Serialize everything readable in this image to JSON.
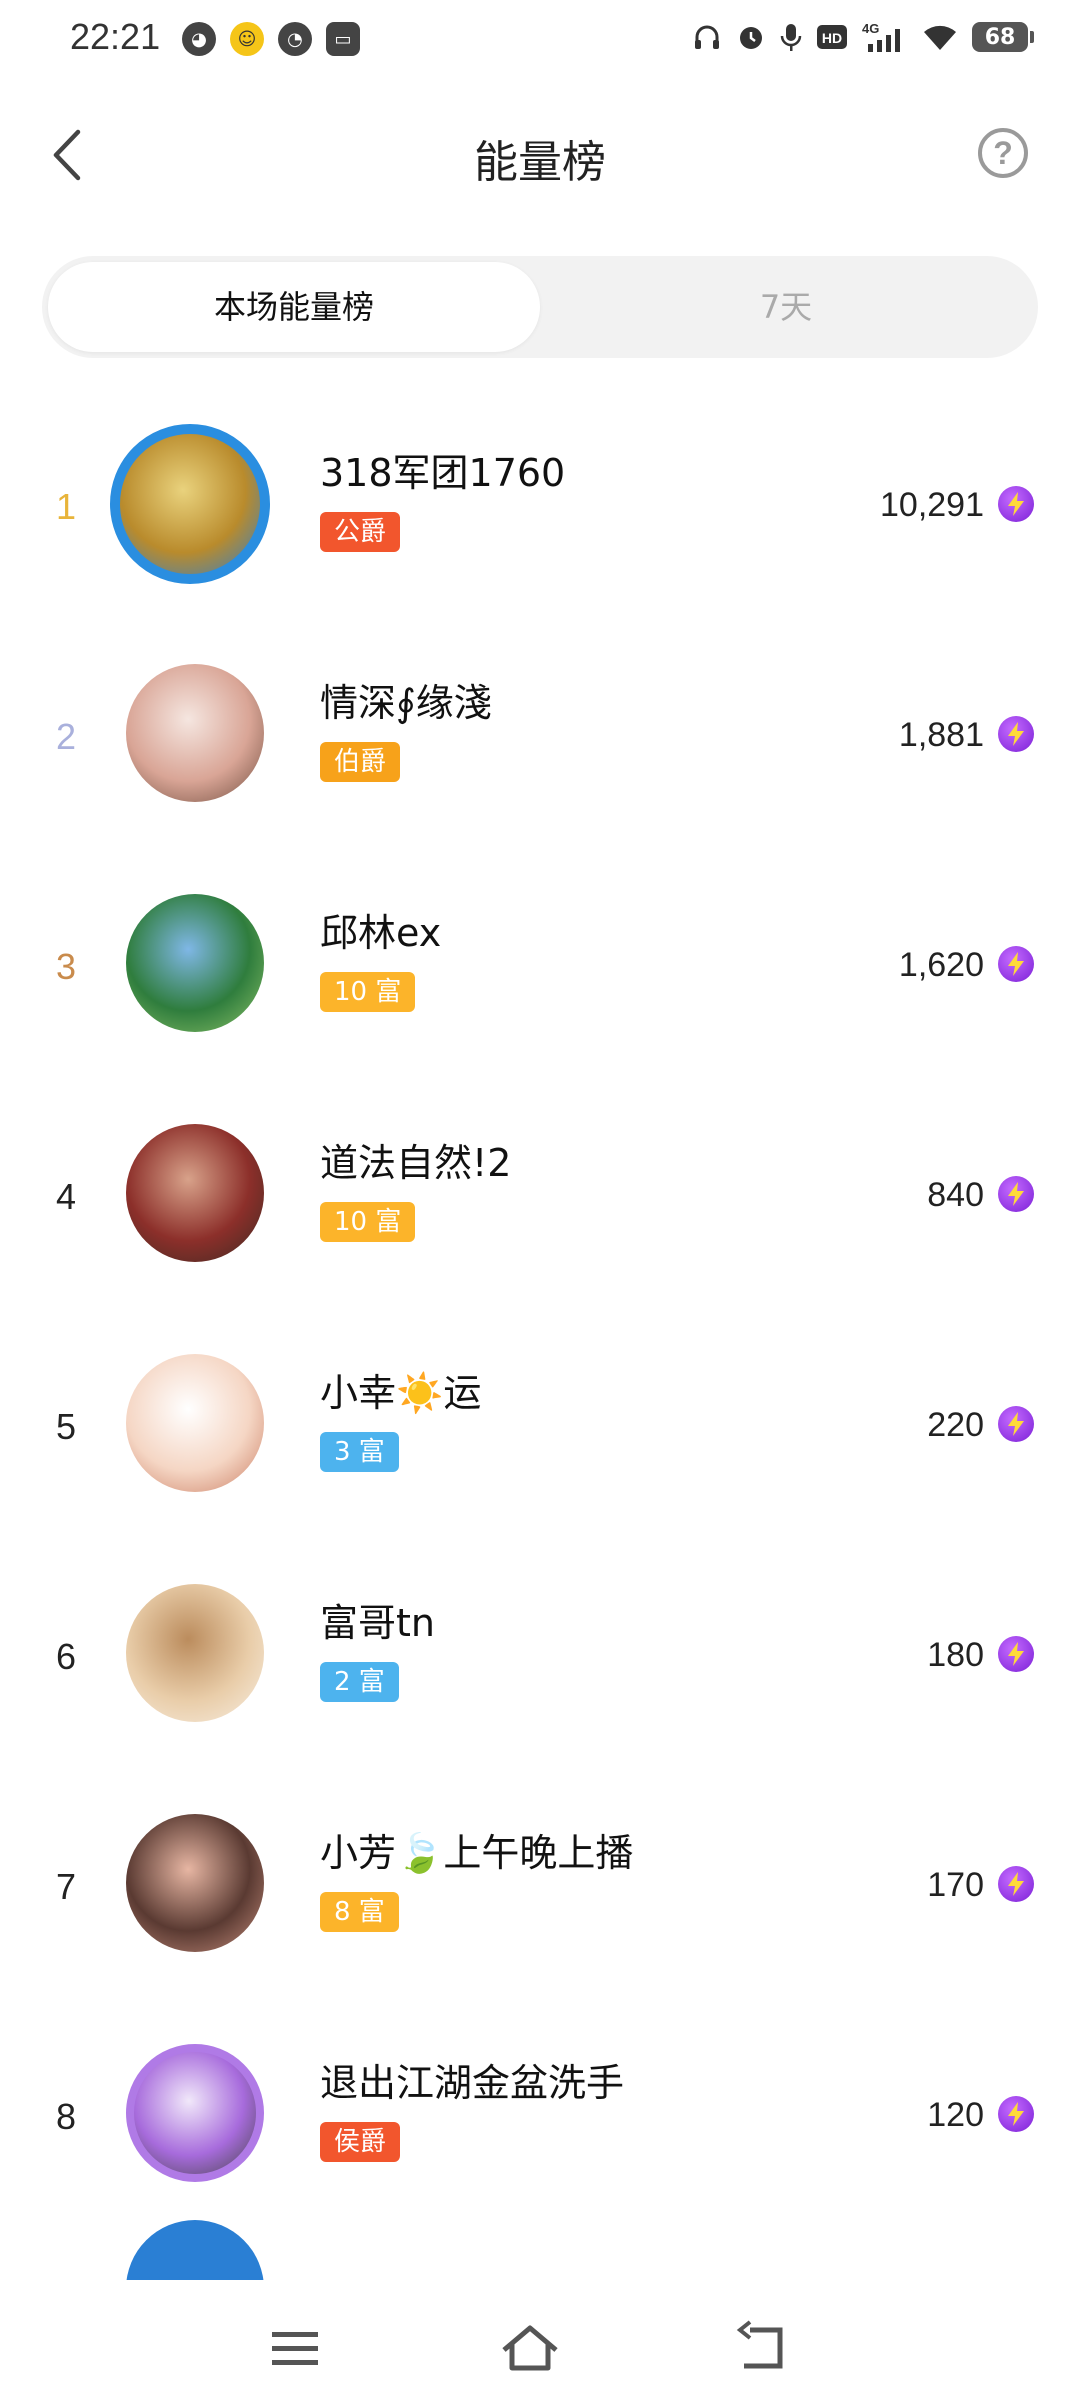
{
  "status_bar": {
    "time": "22:21",
    "network": "4G",
    "battery": "68"
  },
  "header": {
    "title": "能量榜",
    "help": "?"
  },
  "tabs": [
    {
      "label": "本场能量榜",
      "active": true
    },
    {
      "label": "7天",
      "active": false
    }
  ],
  "ranking": [
    {
      "rank": "1",
      "name": "318军团1760",
      "badge": "公爵",
      "score": "10,291",
      "rank_color": "#e8b43a",
      "badge_color": "#f2562d",
      "avatar_colors": [
        "#b98b2c",
        "#e9d27d",
        "#2a7fd4"
      ]
    },
    {
      "rank": "2",
      "name": "情深∮缘淺",
      "badge": "伯爵",
      "score": "1,881",
      "rank_color": "#a9b0dc",
      "badge_color": "#f7a21a",
      "avatar_colors": [
        "#d9a596",
        "#f5e6e0",
        "#6d4a3b"
      ]
    },
    {
      "rank": "3",
      "name": "邱林ex",
      "badge": "10 富",
      "score": "1,620",
      "rank_color": "#c98b4c",
      "badge_color": "#fcb42a",
      "avatar_colors": [
        "#2f7d3d",
        "#7fb7e6",
        "#8fc46a"
      ]
    },
    {
      "rank": "4",
      "name": "道法自然!2",
      "badge": "10 富",
      "score": "840",
      "rank_color": "#222222",
      "badge_color": "#fcb42a",
      "avatar_colors": [
        "#8c2f2a",
        "#d8a28a",
        "#3a2a22"
      ]
    },
    {
      "rank": "5",
      "name": "小幸☀️运",
      "badge": "3 富",
      "score": "220",
      "rank_color": "#222222",
      "badge_color": "#4db3ee",
      "avatar_colors": [
        "#f5d6c4",
        "#ffffff",
        "#c97a5f"
      ]
    },
    {
      "rank": "6",
      "name": "富哥tn",
      "badge": "2 富",
      "score": "180",
      "rank_color": "#222222",
      "badge_color": "#4db3ee",
      "avatar_colors": [
        "#e9cda9",
        "#bb8c5d",
        "#f8efe3"
      ]
    },
    {
      "rank": "7",
      "name": "小芳🍃上午晚上播",
      "badge": "8 富",
      "score": "170",
      "rank_color": "#222222",
      "badge_color": "#fcb42a",
      "avatar_colors": [
        "#5a3a32",
        "#e7b6a3",
        "#c78e7d"
      ]
    },
    {
      "rank": "8",
      "name": "退出江湖金盆洗手",
      "badge": "侯爵",
      "score": "120",
      "rank_color": "#222222",
      "badge_color": "#f2562d",
      "avatar_colors": [
        "#a76bdc",
        "#f1e8fa",
        "#444444"
      ]
    }
  ]
}
